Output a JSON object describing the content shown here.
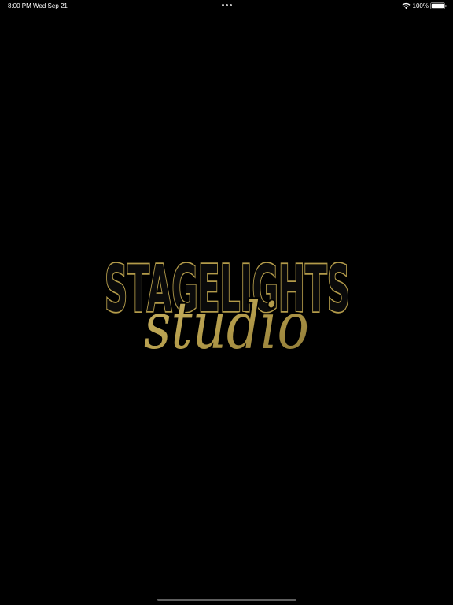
{
  "status_bar": {
    "time": "8:00 PM",
    "date": "Wed Sep 21",
    "battery": "100%"
  },
  "logo": {
    "wordmark_top": "STAGELIGHTS",
    "wordmark_script": "studio"
  },
  "colors": {
    "background": "#000000",
    "gold": "#b39b4a",
    "gold_light": "#cbb566",
    "gold_dark": "#8b7634"
  },
  "icons": {
    "wifi": "wifi-icon",
    "battery": "battery-icon",
    "multitask": "multitasking-dots-icon"
  }
}
